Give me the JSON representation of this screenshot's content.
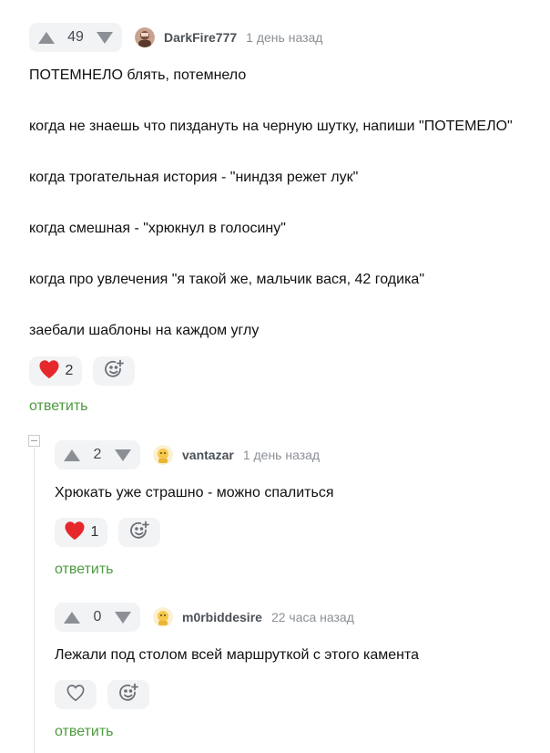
{
  "comments": [
    {
      "rating": "49",
      "author": "DarkFire777",
      "time": "1 день назад",
      "lines": [
        "ПОТЕМНЕЛО блять, потемнело",
        "когда не знаешь что пиздануть на черную шутку, напиши \"ПОТЕМЕЛО\"",
        "когда трогательная история - \"ниндзя режет лук\"",
        "когда смешная - \"хрюкнул в голосину\"",
        "когда про увлечения \"я такой же, мальчик вася, 42 годика\"",
        "заебали шаблоны на каждом углу"
      ],
      "likes": "2",
      "reply": "ответить"
    },
    {
      "rating": "2",
      "author": "vantazar",
      "time": "1 день назад",
      "lines": [
        "Хрюкать уже страшно - можно спалиться"
      ],
      "likes": "1",
      "reply": "ответить"
    },
    {
      "rating": "0",
      "author": "m0rbiddesire",
      "time": "22 часа назад",
      "lines": [
        "Лежали под столом всей маршруткой с этого камента"
      ],
      "likes": "",
      "reply": "ответить"
    }
  ],
  "colors": {
    "accent_green": "#4c9a3e",
    "heart_red": "#e5282c",
    "pill_bg": "#f2f3f5"
  },
  "icons": [
    "arrow-up-icon",
    "arrow-down-icon",
    "heart-icon",
    "add-reaction-icon",
    "collapse-thread-icon"
  ]
}
